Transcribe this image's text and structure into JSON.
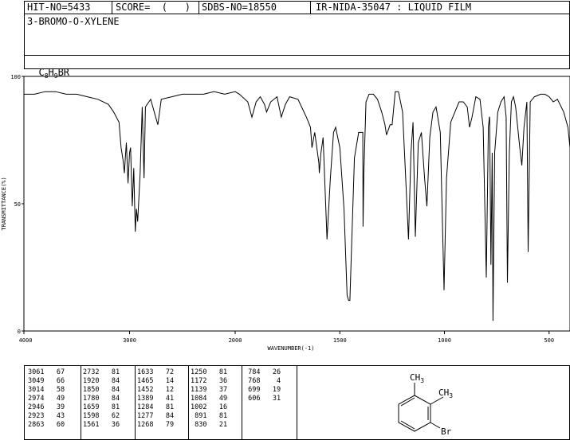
{
  "header": {
    "hit_no": "HIT-NO=5433",
    "score": "SCORE=  (   )",
    "sdbs_no": "SDBS-NO=18550",
    "ir_nida": "IR-NIDA-35047 : LIQUID FILM",
    "compound_name": "3-BROMO-O-XYLENE",
    "formula": {
      "c": "C",
      "c_sub": "8",
      "h": "H",
      "h_sub": "9",
      "rest": "BR"
    }
  },
  "chart_data": {
    "type": "line",
    "title": "",
    "xlabel": "WAVENUMBER(-1)",
    "ylabel": "TRANSMITTANCE(%)",
    "xlim": [
      4000,
      400
    ],
    "ylim": [
      0,
      100
    ],
    "x_ticks": [
      4000,
      3000,
      2000,
      1500,
      1000,
      500
    ],
    "y_ticks": [
      0,
      50,
      100
    ],
    "grid": false,
    "series": [
      {
        "name": "",
        "x": [
          4000,
          3900,
          3800,
          3700,
          3600,
          3500,
          3400,
          3300,
          3200,
          3150,
          3100,
          3080,
          3061,
          3049,
          3040,
          3030,
          3014,
          3000,
          2990,
          2974,
          2960,
          2946,
          2935,
          2923,
          2900,
          2880,
          2863,
          2850,
          2800,
          2732,
          2700,
          2600,
          2500,
          2400,
          2300,
          2200,
          2100,
          2000,
          1980,
          1940,
          1920,
          1900,
          1880,
          1860,
          1850,
          1830,
          1800,
          1780,
          1760,
          1740,
          1700,
          1660,
          1650,
          1640,
          1633,
          1620,
          1600,
          1598,
          1590,
          1580,
          1561,
          1545,
          1530,
          1520,
          1500,
          1480,
          1465,
          1458,
          1452,
          1445,
          1430,
          1410,
          1390,
          1389,
          1385,
          1375,
          1360,
          1340,
          1320,
          1300,
          1284,
          1277,
          1268,
          1260,
          1250,
          1235,
          1220,
          1200,
          1185,
          1172,
          1160,
          1150,
          1139,
          1125,
          1110,
          1095,
          1084,
          1070,
          1055,
          1040,
          1020,
          1002,
          990,
          970,
          950,
          930,
          910,
          891,
          880,
          868,
          850,
          830,
          815,
          800,
          790,
          785,
          784,
          778,
          772,
          768,
          760,
          745,
          730,
          715,
          705,
          699,
          690,
          680,
          670,
          660,
          650,
          640,
          630,
          620,
          606,
          600,
          590,
          570,
          540,
          520,
          500,
          480,
          460,
          430,
          410,
          400
        ],
        "y": [
          93,
          93,
          94,
          94,
          93,
          93,
          92,
          91,
          89,
          86,
          82,
          72,
          67,
          62,
          68,
          74,
          58,
          70,
          72,
          49,
          64,
          39,
          48,
          43,
          62,
          88,
          60,
          88,
          91,
          81,
          91,
          92,
          93,
          93,
          93,
          94,
          93,
          94,
          93,
          90,
          84,
          90,
          92,
          89,
          86,
          90,
          92,
          84,
          89,
          92,
          91,
          84,
          82,
          80,
          72,
          78,
          66,
          62,
          70,
          76,
          36,
          60,
          78,
          80,
          72,
          48,
          14,
          12,
          12,
          30,
          68,
          78,
          78,
          41,
          62,
          90,
          93,
          93,
          91,
          86,
          81,
          77,
          79,
          81,
          81,
          94,
          94,
          86,
          60,
          36,
          70,
          82,
          37,
          74,
          78,
          60,
          49,
          76,
          86,
          88,
          78,
          16,
          60,
          82,
          86,
          90,
          90,
          88,
          80,
          84,
          92,
          91,
          80,
          21,
          80,
          84,
          84,
          26,
          70,
          4,
          70,
          86,
          90,
          92,
          84,
          19,
          70,
          90,
          92,
          88,
          80,
          72,
          65,
          80,
          90,
          31,
          90,
          92,
          93,
          93,
          92,
          90,
          91,
          86,
          80,
          72
        ]
      }
    ],
    "peak_table": [
      [
        [
          3061,
          67
        ],
        [
          3049,
          66
        ],
        [
          3014,
          58
        ],
        [
          2974,
          49
        ],
        [
          2946,
          39
        ],
        [
          2923,
          43
        ],
        [
          2863,
          60
        ]
      ],
      [
        [
          2732,
          81
        ],
        [
          1920,
          84
        ],
        [
          1850,
          84
        ],
        [
          1780,
          84
        ],
        [
          1659,
          81
        ],
        [
          1598,
          62
        ],
        [
          1561,
          36
        ]
      ],
      [
        [
          1633,
          72
        ],
        [
          1465,
          14
        ],
        [
          1452,
          12
        ],
        [
          1389,
          41
        ],
        [
          1284,
          81
        ],
        [
          1277,
          84
        ],
        [
          1268,
          79
        ]
      ],
      [
        [
          1250,
          81
        ],
        [
          1172,
          36
        ],
        [
          1139,
          37
        ],
        [
          1084,
          49
        ],
        [
          1002,
          16
        ],
        [
          891,
          81
        ],
        [
          830,
          21
        ]
      ],
      [
        [
          784,
          26
        ],
        [
          768,
          4
        ],
        [
          699,
          19
        ],
        [
          606,
          31
        ]
      ]
    ]
  },
  "structure": {
    "methyl_top": "CH3",
    "methyl_right": "CH3",
    "halogen": "Br"
  }
}
